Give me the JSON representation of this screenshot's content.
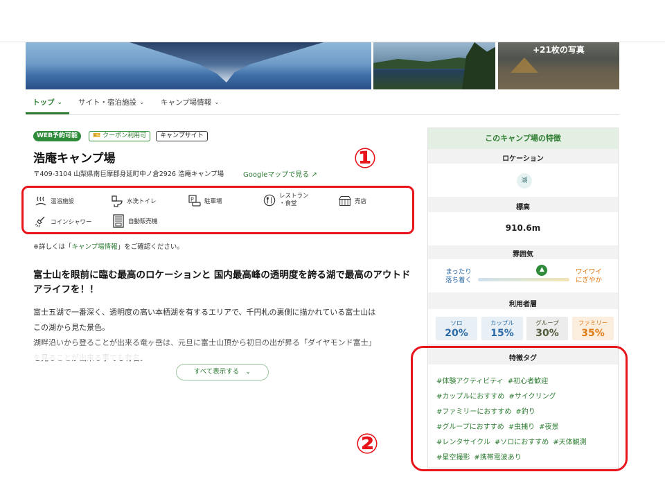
{
  "photos": {
    "more_label": "+21枚の写真"
  },
  "nav": {
    "tabs": [
      {
        "label": "トップ"
      },
      {
        "label": "サイト・宿泊施設"
      },
      {
        "label": "キャンプ場情報"
      }
    ]
  },
  "badges": {
    "web": "WEB予約可能",
    "coupon": "クーポン利用可",
    "camp_site": "キャンプサイト"
  },
  "campsite": {
    "name": "浩庵キャンプ場",
    "address": "〒409-3104 山梨県南巨摩郡身延町中ノ倉2926 浩庵キャンプ場",
    "map_link": "Googleマップで見る"
  },
  "amenities": [
    {
      "label": "温浴施設",
      "icon": "onsen-icon"
    },
    {
      "label": "水洗トイレ",
      "icon": "toilet-icon"
    },
    {
      "label": "駐車場",
      "icon": "parking-icon"
    },
    {
      "label": "レストラン\n・食堂",
      "icon": "restaurant-icon"
    },
    {
      "label": "売店",
      "icon": "shop-icon"
    },
    {
      "label": "コインシャワー",
      "icon": "shower-icon"
    },
    {
      "label": "自動販売機",
      "icon": "vending-machine-icon"
    }
  ],
  "note": {
    "prefix": "※詳しくは「",
    "link": "キャンプ場情報",
    "suffix": "」をご確認ください。"
  },
  "description": {
    "heading": "富士山を眼前に臨む最高のロケーションと 国内最高峰の透明度を誇る湖で最高のアウトドアライフを！！",
    "line1": "富士五湖で一番深く、透明度の高い本栖湖を有するエリアで、千円札の裏側に描かれている富士山は",
    "line2": "この湖から見た景色。",
    "line3": "湖畔沿いから登ることが出来る竜ヶ岳は、元旦に富士山頂から初日の出が昇る「ダイヤモンド富士」",
    "line4": "を見ることが出来る事でも有名。",
    "show_all": "すべて表示する"
  },
  "features": {
    "title": "このキャンプ場の特徴",
    "location_label": "ロケーション",
    "location_value": "湖",
    "elevation_label": "標高",
    "elevation_value": "910.6m",
    "mood_label": "雰囲気",
    "mood_left": "まったり\n落ち着く",
    "mood_right": "ワイワイ\nにぎやか",
    "mood_level": 0.7,
    "users_label": "利用者層",
    "users": [
      {
        "label": "ソロ",
        "value": "20%",
        "color": "#2a6aa5",
        "bg": "#e8f0f6"
      },
      {
        "label": "カップル",
        "value": "15%",
        "color": "#2a6aa5",
        "bg": "#e8f0f6"
      },
      {
        "label": "グループ",
        "value": "30%",
        "color": "#4f5a3a",
        "bg": "#ececec"
      },
      {
        "label": "ファミリー",
        "value": "35%",
        "color": "#e07a13",
        "bg": "#fbeede"
      }
    ],
    "tags_label": "特徴タグ",
    "tags": [
      "#体験アクティビティ",
      "#初心者歓迎",
      "#カップルにおすすめ",
      "#サイクリング",
      "#ファミリーにおすすめ",
      "#釣り",
      "#グループにおすすめ",
      "#虫捕り",
      "#夜景",
      "#レンタサイクル",
      "#ソロにおすすめ",
      "#天体観測",
      "#星空撮影",
      "#携帯電波あり"
    ]
  },
  "annotations": {
    "one": "①",
    "two": "②"
  },
  "colors": {
    "accent": "#2e7d32",
    "highlight": "#e8141b"
  }
}
